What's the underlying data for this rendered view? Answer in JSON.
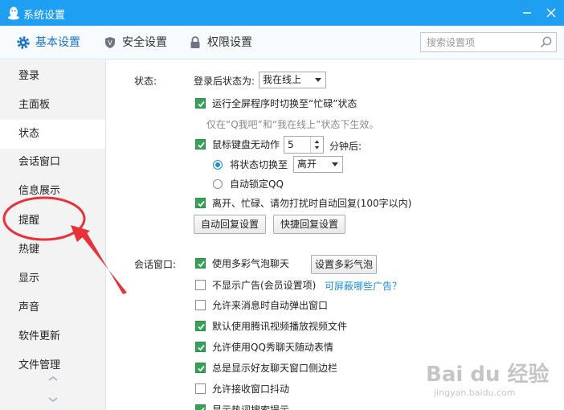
{
  "window": {
    "title": "系统设置"
  },
  "toolbar": {
    "tabs": [
      {
        "label": "基本设置",
        "active": true
      },
      {
        "label": "安全设置",
        "active": false
      },
      {
        "label": "权限设置",
        "active": false
      }
    ],
    "search_placeholder": "搜索设置项"
  },
  "sidebar": {
    "items": [
      "登录",
      "主面板",
      "状态",
      "会话窗口",
      "信息展示",
      "提醒",
      "热键",
      "显示",
      "声音",
      "软件更新",
      "文件管理"
    ],
    "active_index": 2
  },
  "status": {
    "section_label": "状态:",
    "login_status_label": "登录后状态为:",
    "login_status_value": "我在线上",
    "fullscreen_busy": "运行全屏程序时切换至“忙碌”状态",
    "fullscreen_hint": "仅在“Q我吧”和“我在线上”状态下生效。",
    "idle_prefix": "鼠标键盘无动作",
    "idle_minutes": "5",
    "idle_suffix": "分钟后:",
    "switch_to_label": "将状态切换至",
    "switch_to_value": "离开",
    "auto_lock": "自动锁定QQ",
    "auto_reply": "离开、忙碌、请勿打扰时自动回复(100字以内)",
    "auto_reply_btn": "自动回复设置",
    "quick_reply_btn": "快捷回复设置"
  },
  "chat": {
    "section_label": "会话窗口:",
    "bubble": "使用多彩气泡聊天",
    "bubble_btn": "设置多彩气泡",
    "no_ads": "不显示广告(会员设置项)",
    "no_ads_link": "可屏蔽哪些广告？",
    "popup": "允许来消息时自动弹出窗口",
    "video": "默认使用腾讯视频播放视频文件",
    "qqshow": "允许使用QQ秀聊天随动表情",
    "sidebar": "总是显示好友聊天窗口侧边栏",
    "shake": "允许接收窗口抖动",
    "hotwords": "显示热词搜索提示"
  },
  "watermark": {
    "brand": "Bai du 经验",
    "url": "jingyan.baidu.com"
  },
  "colors": {
    "titlebar": "#1e9ff2",
    "accent": "#1a73c9",
    "check": "#33a457",
    "annotation": "#e8323a"
  }
}
